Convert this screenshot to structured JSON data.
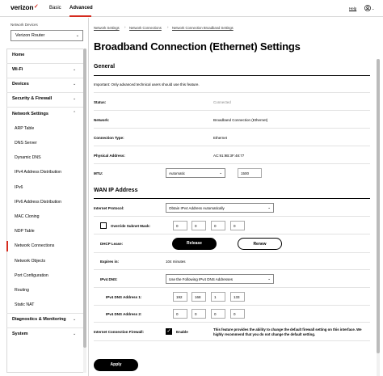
{
  "topbar": {
    "brand": "verizon",
    "tabs": [
      {
        "label": "Basic"
      },
      {
        "label": "Advanced"
      }
    ],
    "help_label": "Help",
    "user_icon": "user-icon"
  },
  "sidebar": {
    "network_devices_label": "Network Devices",
    "network_devices_value": "Verizon Router",
    "items": [
      {
        "label": "Home"
      },
      {
        "label": "Wi-Fi"
      },
      {
        "label": "Devices"
      },
      {
        "label": "Security & Firewall"
      },
      {
        "label": "Network Settings"
      },
      {
        "label": "ARP Table"
      },
      {
        "label": "DNS Server"
      },
      {
        "label": "Dynamic DNS"
      },
      {
        "label": "IPv4 Address Distribution"
      },
      {
        "label": "IPv6"
      },
      {
        "label": "IPv6 Address Distribution"
      },
      {
        "label": "MAC Cloning"
      },
      {
        "label": "NDP Table"
      },
      {
        "label": "Network Connections"
      },
      {
        "label": "Network Objects"
      },
      {
        "label": "Port Configuration"
      },
      {
        "label": "Routing"
      },
      {
        "label": "Static NAT"
      },
      {
        "label": "Diagnostics & Monitoring"
      },
      {
        "label": "System"
      }
    ]
  },
  "breadcrumb": [
    "Network Settings",
    "Network Connections",
    "Network Connection Broadband Settings"
  ],
  "page_title": "Broadband Connection (Ethernet) Settings",
  "general": {
    "title": "General",
    "note": "Important: Only advanced technical users should use this feature.",
    "status_label": "Status:",
    "status_value": "Connected",
    "network_label": "Network:",
    "network_value": "Broadband Connection (Ethernet)",
    "conn_type_label": "Connection Type:",
    "conn_type_value": "Ethernet",
    "phys_label": "Physical Address:",
    "phys_value": "AC:91:9B:3F:48:77",
    "mtu_label": "MTU:",
    "mtu_mode": "Automatic",
    "mtu_value": "1500"
  },
  "wan": {
    "title": "WAN IP Address",
    "protocol_label": "Internet Protocol:",
    "protocol_value": "Obtain IPv4 Address Automatically",
    "subnet_label": "Override Subnet Mask:",
    "subnet_octets": [
      "0",
      "0",
      "0",
      "0"
    ],
    "dhcp_label": "DHCP Lease:",
    "release_label": "Release",
    "renew_label": "Renew",
    "expires_label": "Expires in:",
    "expires_value": "104 minutes",
    "dns_label": "IPv4 DNS:",
    "dns_value": "Use the Following IPv4 DNS Addresses",
    "dns1_label": "IPv4 DNS Address 1:",
    "dns1_octets": [
      "192",
      "168",
      "1",
      "133"
    ],
    "dns2_label": "IPv4 DNS Address 2:",
    "dns2_octets": [
      "0",
      "0",
      "0",
      "0"
    ],
    "firewall_label": "Internet Connection Firewall:",
    "firewall_enable_label": "Enable",
    "firewall_checked": true,
    "firewall_note": "This feature provides the ability to change the default firewall setting on this interface. We highly recommend that you do not change the default setting."
  },
  "apply_label": "Apply"
}
